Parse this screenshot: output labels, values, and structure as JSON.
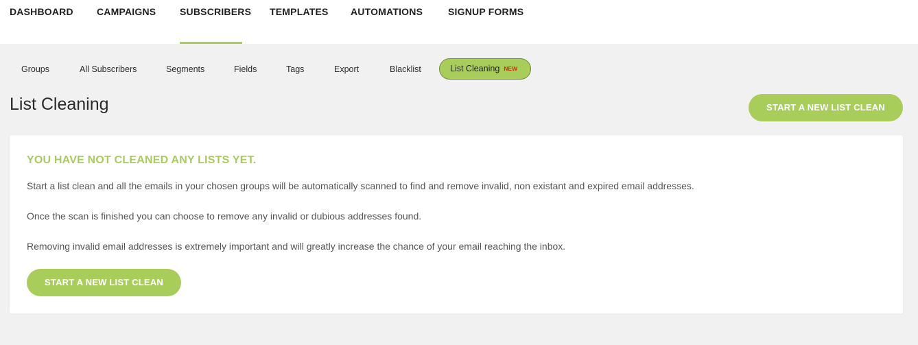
{
  "topnav": {
    "items": [
      {
        "label": "DASHBOARD"
      },
      {
        "label": "CAMPAIGNS"
      },
      {
        "label": "SUBSCRIBERS",
        "active": true
      },
      {
        "label": "TEMPLATES"
      },
      {
        "label": "AUTOMATIONS"
      },
      {
        "label": "SIGNUP FORMS"
      }
    ]
  },
  "subnav": {
    "items": [
      {
        "label": "Groups"
      },
      {
        "label": "All Subscribers"
      },
      {
        "label": "Segments"
      },
      {
        "label": "Fields"
      },
      {
        "label": "Tags"
      },
      {
        "label": "Export"
      },
      {
        "label": "Blacklist"
      }
    ],
    "active": {
      "label": "List Cleaning",
      "badge": "NEW"
    }
  },
  "page": {
    "title": "List Cleaning",
    "header_button": "START A NEW LIST CLEAN"
  },
  "card": {
    "heading": "YOU HAVE NOT CLEANED ANY LISTS YET.",
    "paragraphs": [
      "Start a list clean and all the emails in your chosen groups will be automatically scanned to find and remove invalid, non existant and expired email addresses.",
      "Once the scan is finished you can choose to remove any invalid or dubious addresses found.",
      "Removing invalid email addresses is extremely important and will greatly increase the chance of your email reaching the inbox."
    ],
    "button": "START A NEW LIST CLEAN"
  },
  "colors": {
    "accent": "#a8cd5b",
    "badge": "#e2231a",
    "background": "#f1f1f1"
  }
}
